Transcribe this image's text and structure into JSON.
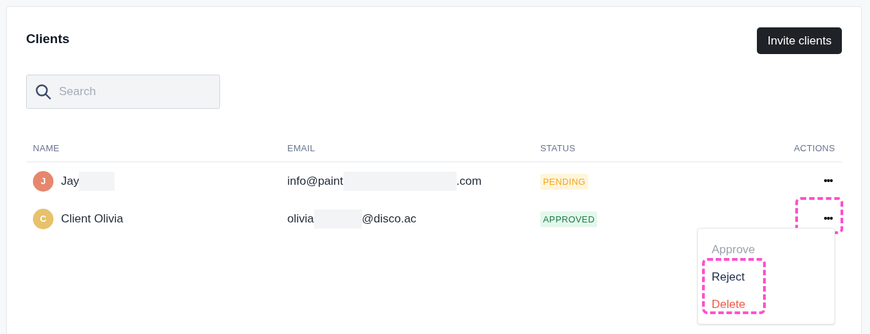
{
  "title": "Clients",
  "invite_button": "Invite clients",
  "search": {
    "placeholder": "Search"
  },
  "table": {
    "columns": [
      "NAME",
      "EMAIL",
      "STATUS",
      "ACTIONS"
    ],
    "rows": [
      {
        "initial": "J",
        "color": "#e6876d",
        "name": [
          {
            "kind": "text",
            "text": "Jay"
          },
          {
            "kind": "redacted"
          }
        ],
        "email": [
          {
            "kind": "text",
            "text": "info@paint"
          },
          {
            "kind": "redacted"
          },
          {
            "kind": "text",
            "text": ".com"
          }
        ],
        "status": {
          "kind": "pending",
          "label": "PENDING"
        },
        "actions": {
          "label": "•••",
          "highlighted": false
        }
      },
      {
        "initial": "C",
        "color": "#e8c16b",
        "name": [
          {
            "kind": "text",
            "text": "Client Olivia"
          }
        ],
        "email": [
          {
            "kind": "text",
            "text": "olivia"
          },
          {
            "kind": "redacted"
          },
          {
            "kind": "text",
            "text": "@disco.ac"
          }
        ],
        "status": {
          "kind": "approved",
          "label": "APPROVED"
        },
        "actions": {
          "label": "•••",
          "highlighted": true
        }
      }
    ]
  },
  "menu": {
    "items": [
      {
        "label": "Approve",
        "kind": "disabled",
        "highlighted": false
      },
      {
        "label": "Reject",
        "kind": "default",
        "highlighted": true
      },
      {
        "label": "Delete",
        "kind": "danger",
        "highlighted": true
      }
    ]
  }
}
